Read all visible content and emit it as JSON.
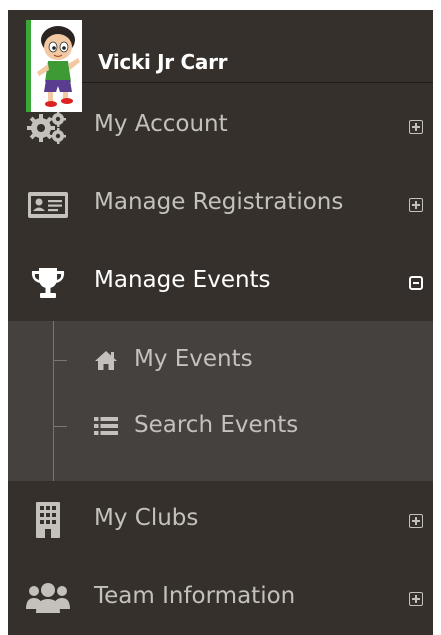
{
  "profile": {
    "name": "Vicki Jr Carr",
    "avatar_icon": "cartoon-boy-avatar"
  },
  "menu": [
    {
      "label": "My Account",
      "icon": "gear-icon",
      "toggle": "expand"
    },
    {
      "label": "Manage Registrations",
      "icon": "id-card-icon",
      "toggle": "expand"
    },
    {
      "label": "Manage Events",
      "icon": "trophy-icon",
      "toggle": "collapse",
      "active": true
    },
    {
      "label": "My Clubs",
      "icon": "building-icon",
      "toggle": "expand"
    },
    {
      "label": "Team Information",
      "icon": "users-icon",
      "toggle": "expand"
    }
  ],
  "submenu": [
    {
      "label": "My Events",
      "icon": "home-icon"
    },
    {
      "label": "Search Events",
      "icon": "list-icon"
    }
  ],
  "colors": {
    "background": "#35302c",
    "submenu_background": "#45413e",
    "avatar_border": "#3aa836",
    "text": "#c4c0bc",
    "active_text": "#ffffff"
  }
}
